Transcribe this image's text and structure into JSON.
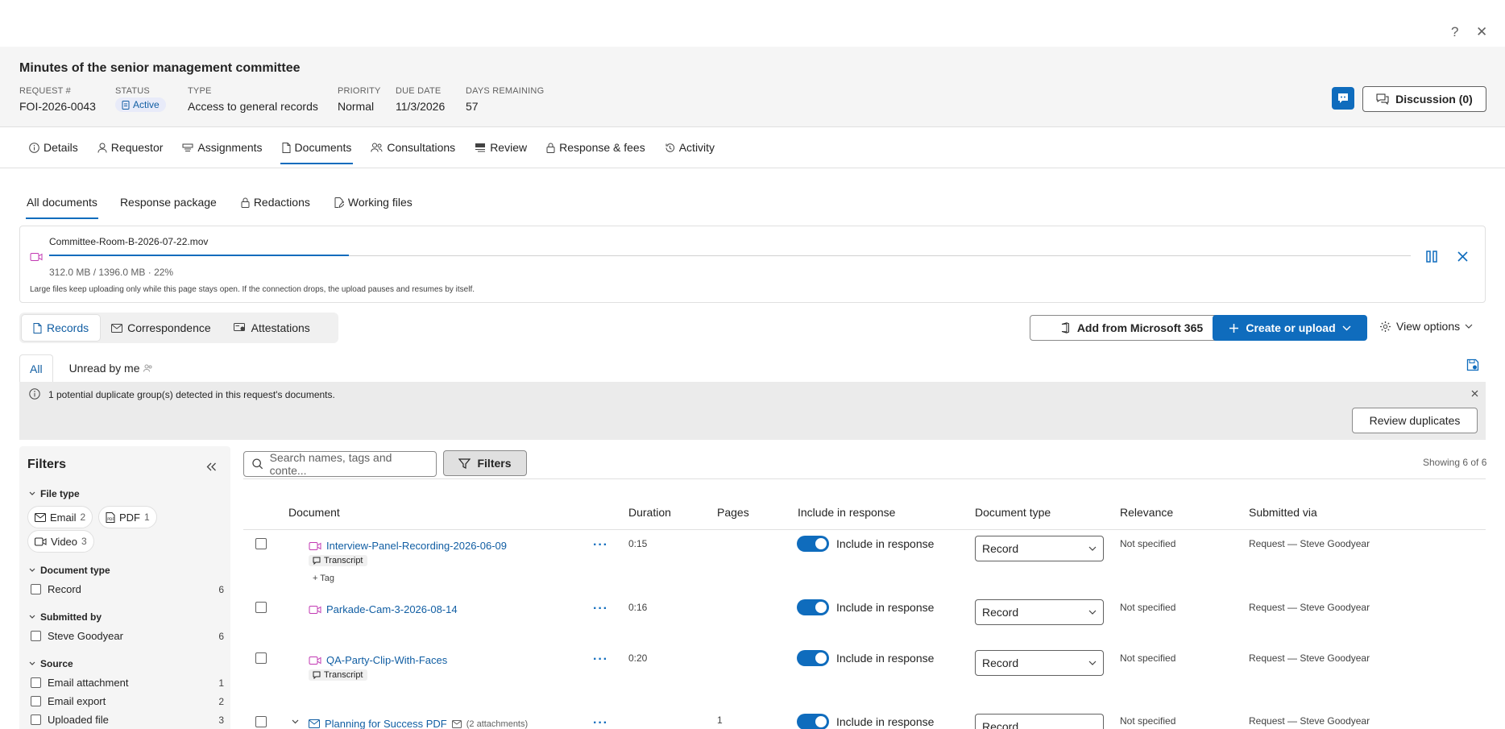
{
  "header": {
    "title": "Minutes of the senior management committee",
    "meta": [
      {
        "label": "REQUEST #",
        "value": "FOI-2026-0043"
      },
      {
        "label": "STATUS",
        "value": "Active"
      },
      {
        "label": "TYPE",
        "value": "Access to general records"
      },
      {
        "label": "PRIORITY",
        "value": "Normal"
      },
      {
        "label": "DUE DATE",
        "value": "11/3/2026"
      },
      {
        "label": "DAYS REMAINING",
        "value": "57"
      }
    ],
    "discussion_label": "Discussion (0)",
    "help_glyph": "?",
    "close_glyph": "✕"
  },
  "main_tabs": [
    "Details",
    "Requestor",
    "Assignments",
    "Documents",
    "Consultations",
    "Review",
    "Response & fees",
    "Activity"
  ],
  "sub_tabs": [
    "All documents",
    "Response package",
    "Redactions",
    "Working files"
  ],
  "upload": {
    "file_name": "Committee-Room-B-2026-07-22.mov",
    "progress_percent": 22,
    "status": "312.0 MB / 1396.0 MB · 22%",
    "note": "Large files keep uploading only while this page stays open. If the connection drops, the upload pauses and resumes by itself."
  },
  "record_tabs": [
    "Records",
    "Correspondence",
    "Attestations"
  ],
  "actions": {
    "add_m365": "Add from Microsoft 365",
    "create_upload": "Create or upload",
    "view_options": "View options"
  },
  "read_filter": [
    "All",
    "Unread by me"
  ],
  "duplicate_banner": {
    "message": "1 potential duplicate group(s) detected in this request's documents.",
    "button": "Review duplicates"
  },
  "filters": {
    "title": "Filters",
    "file_type_label": "File type",
    "file_types": [
      {
        "label": "Email",
        "count": "2"
      },
      {
        "label": "PDF",
        "count": "1"
      },
      {
        "label": "Video",
        "count": "3"
      }
    ],
    "document_type_label": "Document type",
    "document_types": [
      {
        "label": "Record",
        "count": "6"
      }
    ],
    "submitted_by_label": "Submitted by",
    "submitted_by": [
      {
        "label": "Steve Goodyear",
        "count": "6"
      }
    ],
    "source_label": "Source",
    "sources": [
      {
        "label": "Email attachment",
        "count": "1"
      },
      {
        "label": "Email export",
        "count": "2"
      },
      {
        "label": "Uploaded file",
        "count": "3"
      }
    ]
  },
  "toolbar": {
    "search_placeholder": "Search names, tags and conte...",
    "filters_button": "Filters",
    "showing": "Showing 6 of 6"
  },
  "table": {
    "columns": [
      "Document",
      "Duration",
      "Pages",
      "Include in response",
      "Document type",
      "Relevance",
      "Submitted via"
    ],
    "transcript_label": "Transcript",
    "tag_label": "+ Tag",
    "rows": [
      {
        "name": "Interview-Panel-Recording-2026-06-09",
        "duration": "0:15",
        "pages": "",
        "include": "Include in response",
        "doc_type": "Record",
        "relevance": "Not specified",
        "submitted": "Request — Steve Goodyear"
      },
      {
        "name": "Parkade-Cam-3-2026-08-14",
        "duration": "0:16",
        "pages": "",
        "include": "Include in response",
        "doc_type": "Record",
        "relevance": "Not specified",
        "submitted": "Request — Steve Goodyear"
      },
      {
        "name": "QA-Party-Clip-With-Faces",
        "duration": "0:20",
        "pages": "",
        "include": "Include in response",
        "doc_type": "Record",
        "relevance": "Not specified",
        "submitted": "Request — Steve Goodyear"
      },
      {
        "name": "Planning for Success PDF",
        "attachments": "(2 attachments)",
        "duration": "",
        "pages": "1",
        "include": "Include in response",
        "doc_type": "Record",
        "relevance": "Not specified",
        "submitted": "Request — Steve Goodyear"
      }
    ]
  }
}
